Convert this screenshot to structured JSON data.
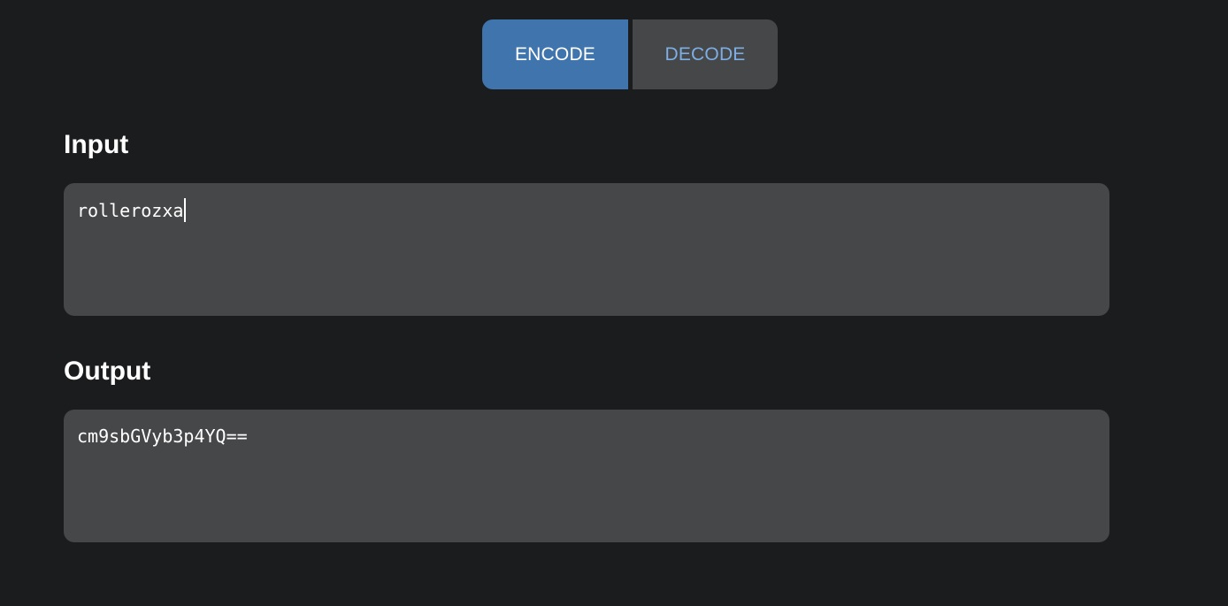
{
  "mode_toggle": {
    "encode_label": "ENCODE",
    "decode_label": "DECODE",
    "active": "encode"
  },
  "input": {
    "label": "Input",
    "value": "rollerozxa"
  },
  "output": {
    "label": "Output",
    "value": "cm9sbGVyb3p4YQ=="
  },
  "colors": {
    "background": "#1b1c1e",
    "panel": "#464749",
    "accent": "#3f74ad",
    "accent_text": "#7daee4"
  }
}
